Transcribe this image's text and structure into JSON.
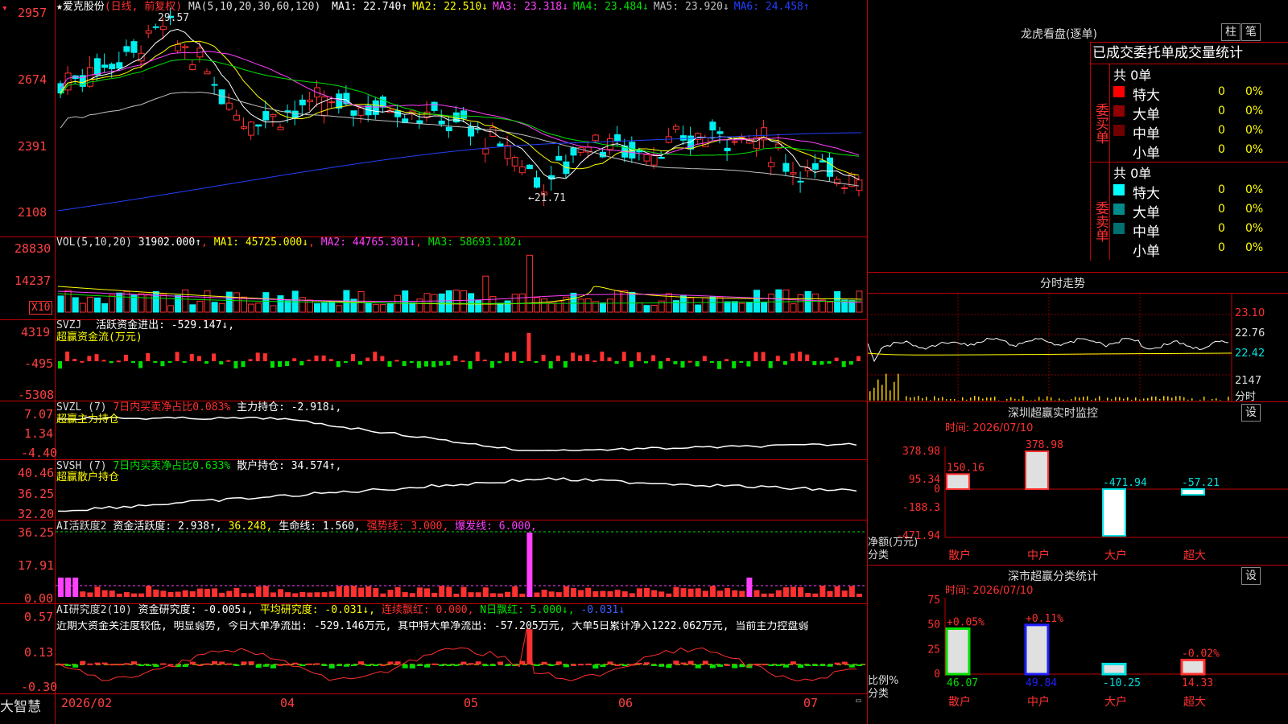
{
  "app_name": "大智慧",
  "stock": {
    "name": "★爱克股份",
    "period": "(日线, 前复权)",
    "peak_label": "29.57",
    "trough_label": "←21.71"
  },
  "colors": {
    "up": "#ff3030",
    "down": "#00f0f0",
    "ma1": "#ffffff",
    "ma2": "#ffff00",
    "ma3": "#ff40ff",
    "ma4": "#00e000",
    "ma5": "#c0c0c0",
    "ma6": "#2040ff"
  },
  "kline": {
    "header": "MA(5,10,20,30,60,120)",
    "ma": [
      {
        "label": "MA1: 22.740↑",
        "color": "#ffffff"
      },
      {
        "label": "MA2: 22.510↓",
        "color": "#ffff00"
      },
      {
        "label": "MA3: 23.318↓",
        "color": "#ff40ff"
      },
      {
        "label": "MA4: 23.484↓",
        "color": "#00e000"
      },
      {
        "label": "MA5: 23.920↓",
        "color": "#c0c0c0"
      },
      {
        "label": "MA6: 24.458↑",
        "color": "#2040ff"
      }
    ],
    "yticks": [
      "2957",
      "2674",
      "2391",
      "2108"
    ]
  },
  "vol": {
    "header": "VOL(5,10,20)",
    "value": "31902.000↑",
    "ma1": "MA1: 45725.000↓",
    "ma2": "MA2: 44765.301↓",
    "ma3": "MA3: 58693.102↓",
    "yticks": [
      "28830",
      "14237"
    ],
    "unit": "X10"
  },
  "svzj": {
    "header": "SVZJ",
    "label": "活跃资金进出: -529.147↓,",
    "sub": "超赢资金流(万元)",
    "yticks": [
      "4319",
      "-495",
      "-5308"
    ]
  },
  "svzl": {
    "header": "SVZL (7)",
    "ratio": "7日内买卖净占比0.083%",
    "hold": "主力持仓: -2.918↓,",
    "sub": "超赢主力持仓",
    "yticks": [
      "7.07",
      "1.34",
      "-4.40"
    ]
  },
  "svsh": {
    "header": "SVSH (7)",
    "ratio": "7日内买卖净占比0.633%",
    "hold": "散户持仓: 34.574↑,",
    "sub": "超赢散户持仓",
    "yticks": [
      "40.46",
      "36.25",
      "32.20"
    ]
  },
  "aihy": {
    "header": "AI活跃度2",
    "a": "资金活跃度: 2.938↑,",
    "b": "36.248,",
    "c": "生命线: 1.560,",
    "d": "强势线: 3.000,",
    "e": "爆发线: 6.000,",
    "yticks": [
      "36.25",
      "17.91",
      "0.00"
    ]
  },
  "aiyj": {
    "header": "AI研究度2(10)",
    "a": "资金研究度: -0.005↓,",
    "b": "平均研究度: -0.031↓,",
    "c": "连续飘红: 0.000,",
    "d": "N日飘红: 5.000↓,",
    "e": "-0.031↓",
    "commentary": "近期大资金关注度较低, 明显弱势, 今日大单净流出: -529.146万元, 其中特大单净流出: -57.205万元, 大单5日累计净入1222.062万元, 当前主力控盘弱",
    "yticks": [
      "0.57",
      "0.13",
      "-0.30"
    ]
  },
  "xaxis": {
    "labels": [
      "2026/02",
      "04",
      "05",
      "06",
      "07"
    ]
  },
  "lhb": {
    "title": "龙虎看盘(逐单)",
    "tab1": "柱",
    "tab2": "笔",
    "head": "已成交委托单成交量统计",
    "buy": {
      "side": "委买单",
      "total": "共 0单",
      "rows": [
        {
          "name": "特大",
          "count": "0",
          "pct": "0%",
          "color": "#ff0000"
        },
        {
          "name": "大单",
          "count": "0",
          "pct": "0%",
          "color": "#900000"
        },
        {
          "name": "中单",
          "count": "0",
          "pct": "0%",
          "color": "#700000"
        },
        {
          "name": "小单",
          "count": "0",
          "pct": "0%",
          "color": ""
        }
      ]
    },
    "sell": {
      "side": "委卖单",
      "total": "共 0单",
      "rows": [
        {
          "name": "特大",
          "count": "0",
          "pct": "0%",
          "color": "#00ffff"
        },
        {
          "name": "大单",
          "count": "0",
          "pct": "0%",
          "color": "#008b8b"
        },
        {
          "name": "中单",
          "count": "0",
          "pct": "0%",
          "color": "#007070"
        },
        {
          "name": "小单",
          "count": "0",
          "pct": "0%",
          "color": ""
        }
      ]
    }
  },
  "fenshi": {
    "title": "分时走势",
    "yticks": [
      "23.10",
      "22.76",
      "22.42"
    ],
    "vol_tick": "2147",
    "vol_unit": "分时"
  },
  "sz_monitor": {
    "title": "深圳超赢实时监控",
    "set": "设",
    "time": "时间: 2026/07/10",
    "ylabel": "净额(万元)",
    "xlabel": "分类",
    "yticks": [
      "378.98",
      "95.34",
      "0",
      "-188.3",
      "-471.94"
    ]
  },
  "sz_stats": {
    "title": "深市超赢分类统计",
    "set": "设",
    "time": "时间: 2026/07/10",
    "ylabel": "比例%",
    "xlabel": "分类",
    "yticks": [
      "75",
      "50",
      "25",
      "0"
    ]
  },
  "chart_data": [
    {
      "type": "bar",
      "title": "深圳超赢实时监控",
      "ylabel": "净额(万元)",
      "xlabel": "分类",
      "categories": [
        "散户",
        "中户",
        "大户",
        "超大"
      ],
      "values": [
        150.16,
        378.98,
        -471.94,
        -57.21
      ],
      "ylim": [
        -471.94,
        378.98
      ]
    },
    {
      "type": "bar",
      "title": "深市超赢分类统计",
      "ylabel": "比例%",
      "xlabel": "分类",
      "categories": [
        "散户",
        "中户",
        "大户",
        "超大"
      ],
      "series": [
        {
          "name": "比例",
          "values": [
            46.07,
            49.84,
            -10.25,
            14.33
          ]
        }
      ],
      "changes": [
        "+0.05%",
        "+0.11%",
        "",
        "-0.02%"
      ],
      "ylim": [
        0,
        75
      ]
    }
  ]
}
